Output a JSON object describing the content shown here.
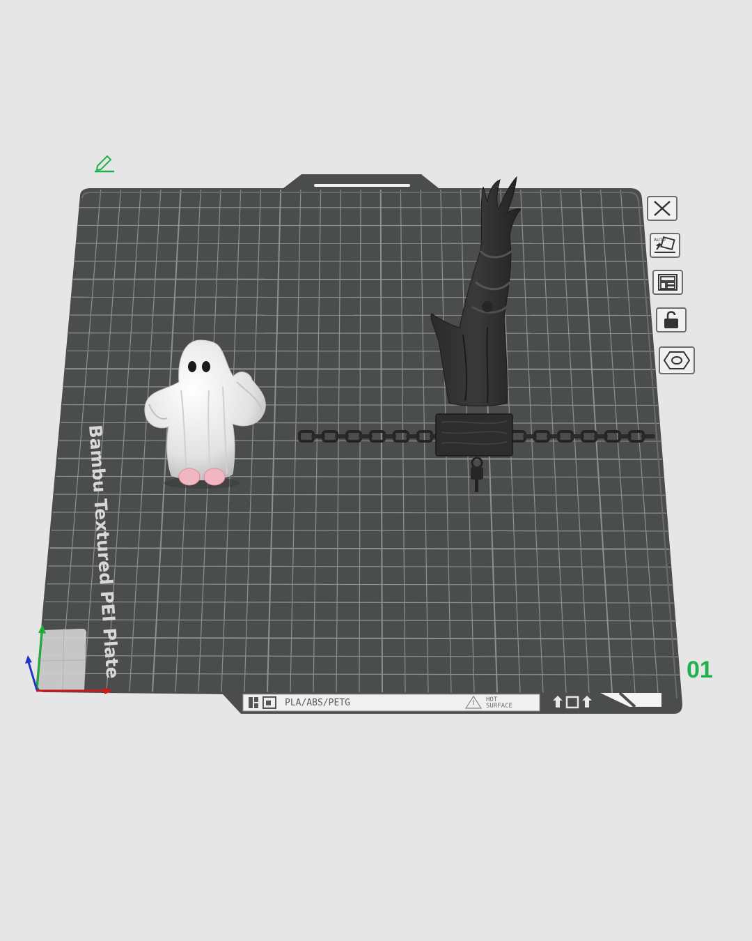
{
  "plate": {
    "name": "Bambu Textured PEI Plate",
    "number": "01",
    "strip_materials": "PLA/ABS/PETG",
    "strip_warning_line1": "HOT",
    "strip_warning_line2": "SURFACE"
  },
  "toolbar": {
    "buttons": [
      {
        "name": "close-plate",
        "icon": "close-icon"
      },
      {
        "name": "auto-orient",
        "icon": "auto-orient-icon",
        "label": "AUTO"
      },
      {
        "name": "arrange",
        "icon": "arrange-icon"
      },
      {
        "name": "lock-plate",
        "icon": "unlock-icon"
      },
      {
        "name": "plate-settings",
        "icon": "hexagon-settings-icon"
      }
    ]
  },
  "colors": {
    "background": "#e6e6e6",
    "plate": "#4b4d4d",
    "grid": "#8e9090",
    "accent_green": "#1fb04d",
    "axis_x": "#d0161c",
    "axis_y": "#1fae3a",
    "axis_z": "#2032c8"
  }
}
